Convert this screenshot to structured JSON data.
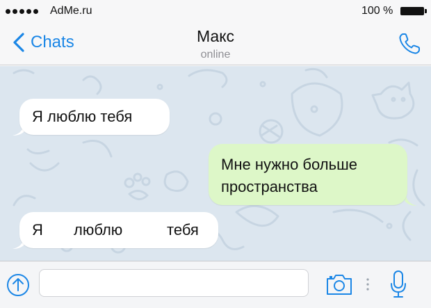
{
  "status_bar": {
    "carrier": "AdMe.ru",
    "battery": "100 %"
  },
  "nav": {
    "back_label": "Chats",
    "contact_name": "Макс",
    "contact_status": "online"
  },
  "messages": [
    {
      "direction": "incoming",
      "text": "Я люблю тебя"
    },
    {
      "direction": "outgoing",
      "lines": [
        "Мне нужно больше",
        "пространства"
      ]
    },
    {
      "direction": "incoming",
      "words": [
        "Я",
        "люблю",
        "тебя"
      ]
    }
  ],
  "input": {
    "placeholder": "",
    "value": ""
  },
  "icons": {
    "back": "chevron-left-icon",
    "call": "phone-icon",
    "attach": "arrow-up-circle-icon",
    "camera": "camera-icon",
    "more": "vertical-dots-icon",
    "mic": "microphone-icon"
  },
  "colors": {
    "accent": "#1a86e6",
    "incoming_bubble": "#ffffff",
    "outgoing_bubble": "#ddf7c8",
    "chat_background": "#dce6ef"
  }
}
